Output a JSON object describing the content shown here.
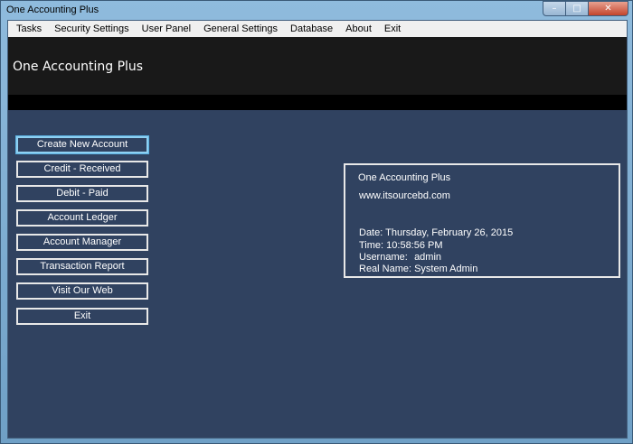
{
  "window": {
    "title": "One Accounting Plus",
    "controls": {
      "minimize": "–",
      "maximize": "□",
      "close": "✕"
    }
  },
  "menu": [
    "Tasks",
    "Security Settings",
    "User Panel",
    "General Settings",
    "Database",
    "About",
    "Exit"
  ],
  "header": {
    "app_title": "One Accounting Plus"
  },
  "buttons": [
    "Create New Account",
    "Credit - Received",
    "Debit - Paid",
    "Account Ledger",
    "Account Manager",
    "Transaction Report",
    "Visit Our Web",
    "Exit"
  ],
  "info": {
    "product": "One Accounting Plus",
    "website": "www.itsourcebd.com",
    "date_label": "Date:",
    "date_value": "Thursday, February 26, 2015",
    "time_label": "Time:",
    "time_value": "10:58:56 PM",
    "username_label": "Username:",
    "username_value": "admin",
    "realname_label": "Real Name:",
    "realname_value": "System Admin"
  }
}
